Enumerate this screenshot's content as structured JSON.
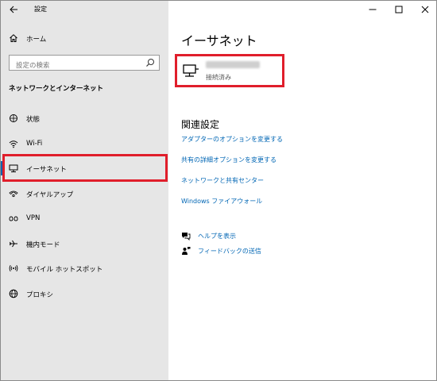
{
  "window": {
    "title": "設定"
  },
  "sidebar": {
    "home_label": "ホーム",
    "search_placeholder": "設定の検索",
    "section_title": "ネットワークとインターネット",
    "items": [
      {
        "label": "状態",
        "icon": "globe-status-icon"
      },
      {
        "label": "Wi-Fi",
        "icon": "wifi-icon"
      },
      {
        "label": "イーサネット",
        "icon": "ethernet-icon",
        "selected": true
      },
      {
        "label": "ダイヤルアップ",
        "icon": "dialup-icon"
      },
      {
        "label": "VPN",
        "icon": "vpn-icon"
      },
      {
        "label": "機内モード",
        "icon": "airplane-icon"
      },
      {
        "label": "モバイル ホットスポット",
        "icon": "hotspot-icon"
      },
      {
        "label": "プロキシ",
        "icon": "globe-icon"
      }
    ]
  },
  "main": {
    "title": "イーサネット",
    "connection": {
      "status": "接続済み"
    },
    "related": {
      "title": "関連設定",
      "links": [
        "アダプターのオプションを変更する",
        "共有の詳細オプションを変更する",
        "ネットワークと共有センター",
        "Windows ファイアウォール"
      ]
    },
    "help": {
      "get_help": "ヘルプを表示",
      "feedback": "フィードバックの送信"
    }
  },
  "colors": {
    "accent": "#0066b4",
    "highlight_box": "#e01e2b",
    "sidebar_bg": "#e6e6e6"
  }
}
